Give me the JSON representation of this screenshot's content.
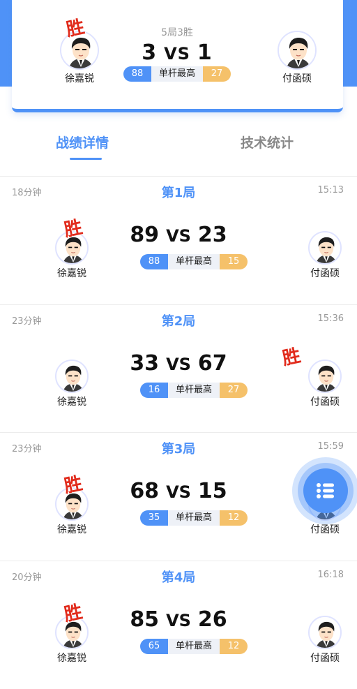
{
  "header": {
    "left_player": "徐嘉锐",
    "right_player": "付函硕",
    "format": "5局3胜",
    "score_left": "3",
    "vs": "VS",
    "score_right": "1",
    "highest_left": "88",
    "highest_label": "单杆最高",
    "highest_right": "27",
    "win_mark": "胜"
  },
  "tabs": [
    {
      "label": "战绩详情",
      "active": true
    },
    {
      "label": "技术统计",
      "active": false
    }
  ],
  "games": [
    {
      "duration": "18分钟",
      "title": "第1局",
      "time": "15:13",
      "left_score": "89",
      "right_score": "23",
      "left_high": "88",
      "right_high": "15",
      "winner": "left",
      "left_name": "徐嘉锐",
      "right_name": "付函硕"
    },
    {
      "duration": "23分钟",
      "title": "第2局",
      "time": "15:36",
      "left_score": "33",
      "right_score": "67",
      "left_high": "16",
      "right_high": "27",
      "winner": "right",
      "left_name": "徐嘉锐",
      "right_name": "付函硕"
    },
    {
      "duration": "23分钟",
      "title": "第3局",
      "time": "15:59",
      "left_score": "68",
      "right_score": "15",
      "left_high": "35",
      "right_high": "12",
      "winner": "left",
      "left_name": "徐嘉锐",
      "right_name": "付函硕"
    },
    {
      "duration": "20分钟",
      "title": "第4局",
      "time": "16:18",
      "left_score": "85",
      "right_score": "26",
      "left_high": "65",
      "right_high": "12",
      "winner": "left",
      "left_name": "徐嘉锐",
      "right_name": "付函硕"
    }
  ],
  "colors": {
    "accent": "#4f92f7",
    "gold": "#f5c16a",
    "win_red": "#e12b1c"
  },
  "icons": {
    "fab": "list-menu-icon",
    "avatar": "avatar-cartoon-icon"
  }
}
